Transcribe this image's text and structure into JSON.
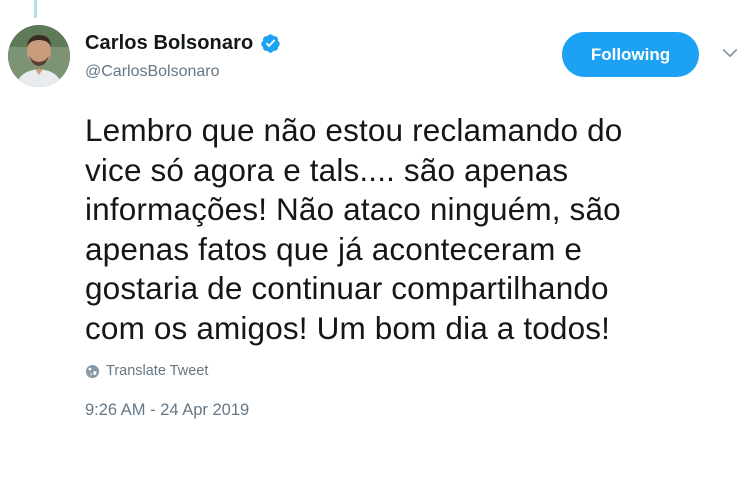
{
  "tweet": {
    "author": {
      "display_name": "Carlos Bolsonaro",
      "handle": "@CarlosBolsonaro",
      "verified": true,
      "avatar_icon": "profile-photo"
    },
    "follow_button_label": "Following",
    "menu_icon": "chevron-down-icon",
    "text": "Lembro que não estou reclamando do\nvice só agora e tals.... são apenas\ninformações! Não ataco ninguém, são\napenas fatos que já aconteceram e\ngostaria de continuar compartilhando\ncom os amigos! Um bom dia a todos!",
    "translate_label": "Translate Tweet",
    "translate_icon": "globe-icon",
    "timestamp": "9:26 AM - 24 Apr 2019"
  },
  "colors": {
    "accent": "#1da1f2",
    "secondary_text": "#657786",
    "primary_text": "#14171a",
    "thread_line": "#b7dcf5"
  }
}
